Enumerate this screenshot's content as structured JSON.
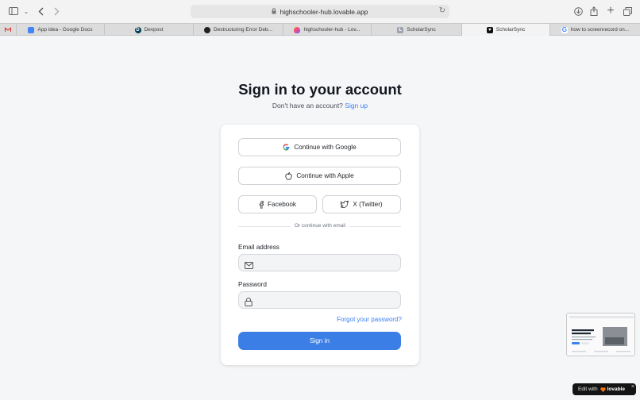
{
  "browser": {
    "url": "highschooler-hub.lovable.app",
    "tabs": [
      {
        "label": "",
        "icon": "gmail-icon",
        "color": "#d93025"
      },
      {
        "label": "App idea - Google Docs",
        "icon": "google-docs-icon",
        "color": "#4285f4"
      },
      {
        "label": "Devpost",
        "icon": "devpost-icon",
        "color": "#003e54"
      },
      {
        "label": "Destructuring Error Deb...",
        "icon": "chatgpt-icon",
        "color": "#202123"
      },
      {
        "label": "highschooler-hub - Lov...",
        "icon": "lovable-icon",
        "color": "#f97316"
      },
      {
        "label": "ScholarSync",
        "icon": "s-letter-icon",
        "color": "#9ca3af"
      },
      {
        "label": "ScholarSync",
        "icon": "heart-icon",
        "color": "#111111"
      },
      {
        "label": "how to screenrecord on...",
        "icon": "google-icon",
        "color": "#4285f4"
      }
    ],
    "active_tab": 6
  },
  "auth": {
    "title": "Sign in to your account",
    "no_account_text": "Don't have an account?",
    "sign_up_link": "Sign up",
    "google_button": "Continue with Google",
    "apple_button": "Continue with Apple",
    "facebook_button": "Facebook",
    "twitter_button": "X (Twitter)",
    "divider_text": "Or continue with email",
    "email_label": "Email address",
    "email_value": "",
    "email_placeholder": "",
    "password_label": "Password",
    "password_value": "",
    "password_placeholder": "",
    "forgot_link": "Forgot your password?",
    "sign_in_button": "Sign in",
    "accent_color": "#3b7fe6"
  },
  "badge": {
    "prefix": "Edit with",
    "brand": "lovable",
    "close": "×"
  }
}
